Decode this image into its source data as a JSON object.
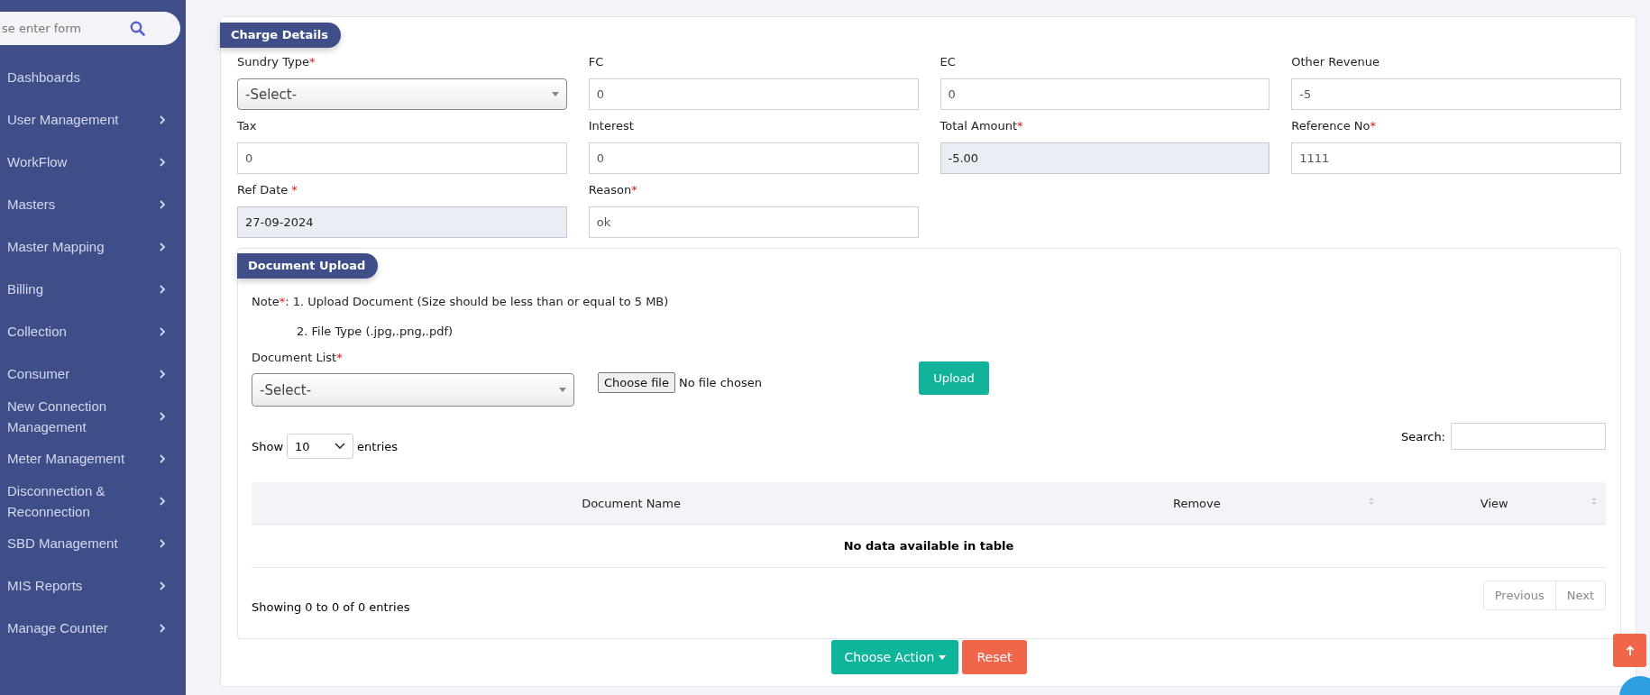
{
  "sidebar": {
    "search": {
      "placeholder": "se enter form"
    },
    "items": [
      {
        "label": "Dashboards",
        "expandable": false
      },
      {
        "label": "User Management",
        "expandable": true
      },
      {
        "label": "WorkFlow",
        "expandable": true
      },
      {
        "label": "Masters",
        "expandable": true
      },
      {
        "label": "Master Mapping",
        "expandable": true
      },
      {
        "label": "Billing",
        "expandable": true
      },
      {
        "label": "Collection",
        "expandable": true
      },
      {
        "label": "Consumer",
        "expandable": true
      },
      {
        "label": "New Connection Management",
        "expandable": true
      },
      {
        "label": "Meter Management",
        "expandable": true
      },
      {
        "label": "Disconnection & Reconnection",
        "expandable": true
      },
      {
        "label": "SBD Management",
        "expandable": true
      },
      {
        "label": "MIS Reports",
        "expandable": true
      },
      {
        "label": "Manage Counter",
        "expandable": true
      }
    ]
  },
  "charge_details": {
    "title": "Charge Details",
    "fields": [
      {
        "label": "Sundry Type",
        "mark": "*",
        "kind": "select",
        "value": "-Select-"
      },
      {
        "label": "FC",
        "kind": "input",
        "value": "0",
        "readonly": false
      },
      {
        "label": "EC",
        "kind": "input",
        "value": "0",
        "readonly": false
      },
      {
        "label": "Other Revenue",
        "kind": "input",
        "value": "-5",
        "readonly": false
      },
      {
        "label": "Tax",
        "kind": "input",
        "value": "0",
        "readonly": false
      },
      {
        "label": "Interest",
        "kind": "input",
        "value": "0",
        "readonly": false
      },
      {
        "label": "Total Amount",
        "mark": "*",
        "kind": "input",
        "value": "-5.00",
        "readonly": true
      },
      {
        "label": "Reference No",
        "mark": "*",
        "kind": "input",
        "value": "1111",
        "readonly": false
      },
      {
        "label": "Ref Date",
        "mark": " *",
        "kind": "input",
        "value": "27-09-2024",
        "readonly": true
      },
      {
        "label": "Reason",
        "mark": "*",
        "kind": "input",
        "value": "ok",
        "readonly": false
      }
    ]
  },
  "document_upload": {
    "title": "Document Upload",
    "note": {
      "label": "Note",
      "mark": "*",
      "line_1": ": 1. Upload Document (Size should be less than or equal to 5 MB)",
      "line_2": "2. File Type (.jpg,.png,.pdf)"
    },
    "document_list": {
      "label": "Document List",
      "mark": "*",
      "value": "-Select-"
    },
    "file": {
      "button": "Choose file",
      "status": "No file chosen"
    },
    "upload_button": "Upload",
    "show": {
      "before": "Show",
      "value": "10",
      "after": "entries"
    },
    "search": {
      "label": "Search:"
    },
    "table": {
      "columns": [
        {
          "label": "Document Name",
          "sortable": false
        },
        {
          "label": "Remove",
          "sortable": true
        },
        {
          "label": "View",
          "sortable": true
        }
      ],
      "empty": "No data available in table"
    },
    "info": "Showing 0 to 0 of 0 entries",
    "pagination": [
      {
        "label": "Previous",
        "disabled": true
      },
      {
        "label": "Next",
        "disabled": true
      }
    ]
  },
  "actions": [
    {
      "label": "Choose Action",
      "kind": "dropdown"
    },
    {
      "label": "Reset",
      "kind": "reset"
    }
  ]
}
